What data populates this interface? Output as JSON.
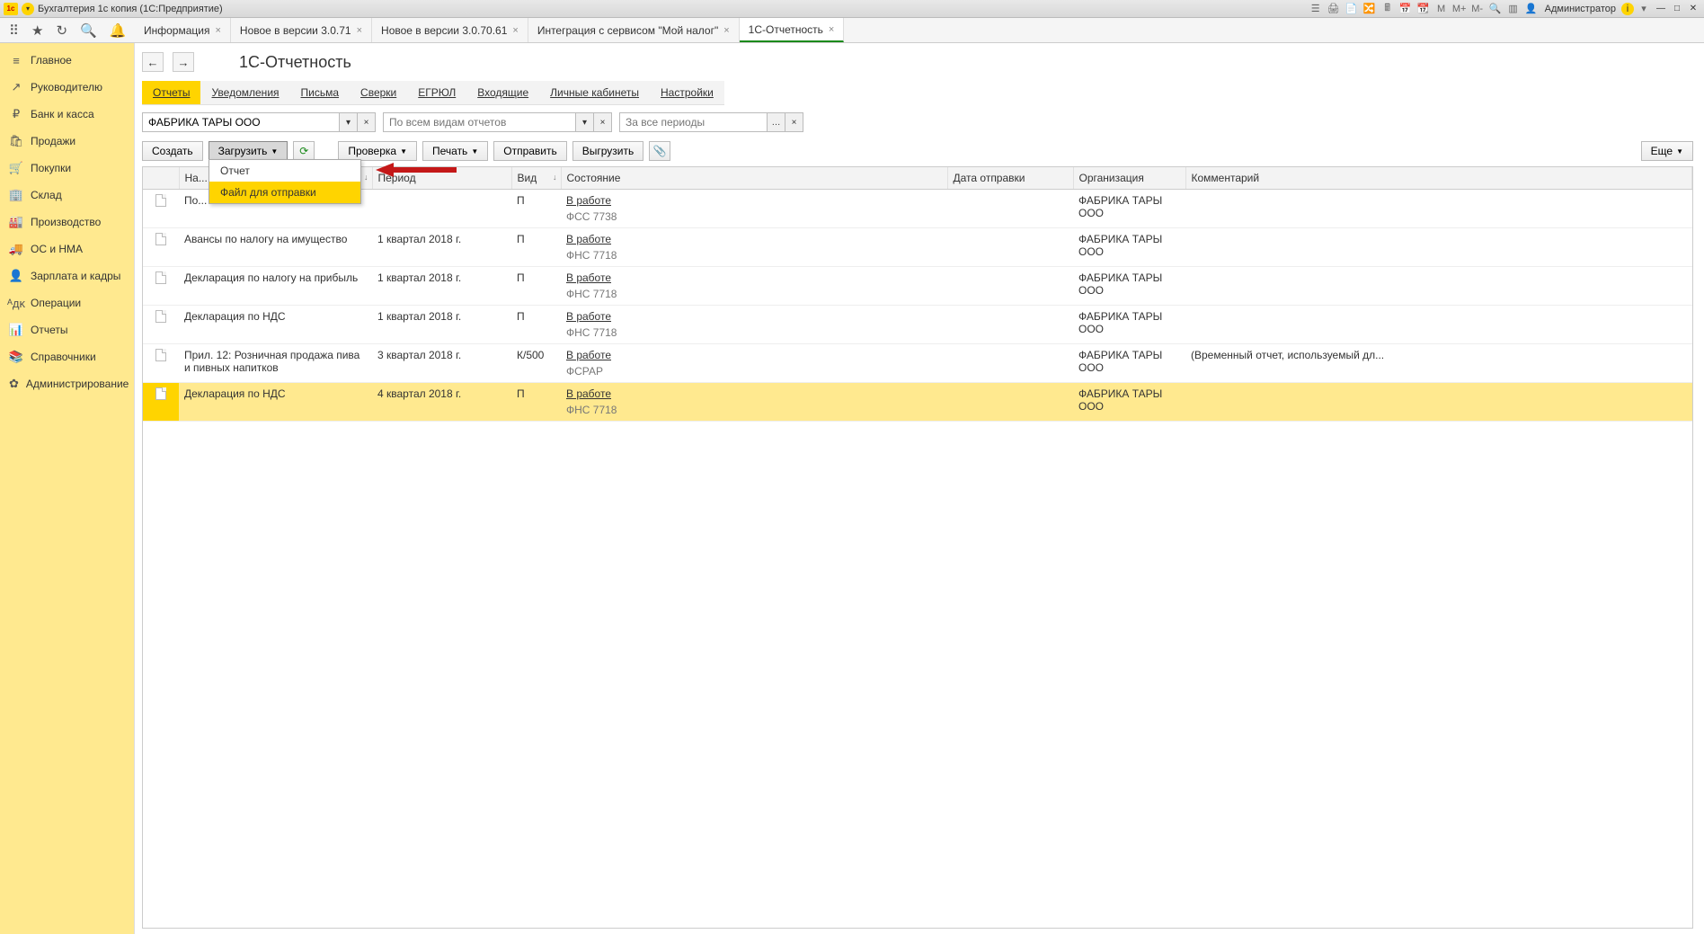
{
  "titlebar": {
    "title": "Бухгалтерия 1с копия  (1С:Предприятие)",
    "user_label": "Администратор",
    "m": "M",
    "mplus": "M+",
    "mminus": "M-"
  },
  "tabs": [
    {
      "label": "Информация"
    },
    {
      "label": "Новое в версии 3.0.71"
    },
    {
      "label": "Новое в версии 3.0.70.61"
    },
    {
      "label": "Интеграция с сервисом \"Мой налог\""
    },
    {
      "label": "1С-Отчетность",
      "active": true
    }
  ],
  "sidebar": [
    {
      "icon": "≡",
      "label": "Главное"
    },
    {
      "icon": "↗",
      "label": "Руководителю"
    },
    {
      "icon": "₽",
      "label": "Банк и касса"
    },
    {
      "icon": "🛍",
      "label": "Продажи"
    },
    {
      "icon": "🛒",
      "label": "Покупки"
    },
    {
      "icon": "🏢",
      "label": "Склад"
    },
    {
      "icon": "🏭",
      "label": "Производство"
    },
    {
      "icon": "🚚",
      "label": "ОС и НМА"
    },
    {
      "icon": "👤",
      "label": "Зарплата и кадры"
    },
    {
      "icon": "ᴬдᴋ",
      "label": "Операции"
    },
    {
      "icon": "📊",
      "label": "Отчеты"
    },
    {
      "icon": "📚",
      "label": "Справочники"
    },
    {
      "icon": "✿",
      "label": "Администрирование"
    }
  ],
  "page": {
    "title": "1С-Отчетность",
    "subnav": [
      "Отчеты",
      "Уведомления",
      "Письма",
      "Сверки",
      "ЕГРЮЛ",
      "Входящие",
      "Личные кабинеты",
      "Настройки"
    ],
    "subnav_active": 0
  },
  "filters": {
    "org": "ФАБРИКА ТАРЫ ООО",
    "kind_ph": "По всем видам отчетов",
    "period_ph": "За все периоды"
  },
  "buttons": {
    "create": "Создать",
    "load": "Загрузить",
    "check": "Проверка",
    "print": "Печать",
    "send": "Отправить",
    "unload": "Выгрузить",
    "more": "Еще"
  },
  "dropdown": {
    "item1": "Отчет",
    "item2": "Файл для отправки"
  },
  "columns": {
    "c0": "",
    "c1": "На...",
    "c2": "Период",
    "c3": "Вид",
    "c4": "Состояние",
    "c5": "Дата отправки",
    "c6": "Организация",
    "c7": "Комментарий"
  },
  "rows": [
    {
      "name": "По...",
      "period": "",
      "vid": "П",
      "state": "В работе",
      "sub": "ФСС 7738",
      "org": "ФАБРИКА ТАРЫ ООО",
      "comment": ""
    },
    {
      "name": "Авансы по налогу на имущество",
      "period": "1 квартал 2018 г.",
      "vid": "П",
      "state": "В работе",
      "sub": "ФНС 7718",
      "org": "ФАБРИКА ТАРЫ ООО",
      "comment": ""
    },
    {
      "name": "Декларация по налогу на прибыль",
      "period": "1 квартал 2018 г.",
      "vid": "П",
      "state": "В работе",
      "sub": "ФНС 7718",
      "org": "ФАБРИКА ТАРЫ ООО",
      "comment": ""
    },
    {
      "name": "Декларация по НДС",
      "period": "1 квартал 2018 г.",
      "vid": "П",
      "state": "В работе",
      "sub": "ФНС 7718",
      "org": "ФАБРИКА ТАРЫ ООО",
      "comment": ""
    },
    {
      "name": "Прил. 12: Розничная продажа пива и пивных напитков",
      "period": "3 квартал 2018 г.",
      "vid": "К/500",
      "state": "В работе",
      "sub": "ФСРАР",
      "org": "ФАБРИКА ТАРЫ ООО",
      "comment": "(Временный отчет, используемый дл..."
    },
    {
      "name": "Декларация по НДС",
      "period": "4 квартал 2018 г.",
      "vid": "П",
      "state": "В работе",
      "sub": "ФНС 7718",
      "org": "ФАБРИКА ТАРЫ ООО",
      "comment": "",
      "selected": true
    }
  ]
}
